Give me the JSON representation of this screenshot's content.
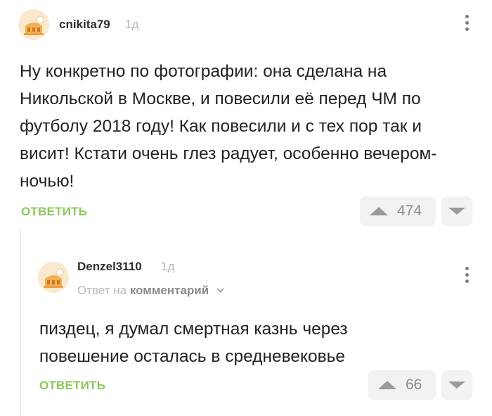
{
  "comment1": {
    "author": "cnikita79",
    "time": "1д",
    "text": "Ну конкретно по фотографии: она сделана на Никольской в Москве, и повесили её перед ЧМ по футболу 2018 году! Как повесили и с тех пор так и висит! Кстати очень глез радует, особенно вечером-ночью!",
    "reply_label": "ОТВЕТИТЬ",
    "rating": "474"
  },
  "comment2": {
    "author": "Denzel3110",
    "time": "1д",
    "reply_to_prefix": "Ответ на",
    "reply_to_link": "комментарий",
    "text": "пиздец, я думал смертная казнь через повешение осталась в средневековье",
    "reply_label": "ОТВЕТИТЬ",
    "rating": "66"
  },
  "colors": {
    "accent": "#8ac858",
    "muted": "#b8b8b8",
    "vote_bg": "#f2f2f2"
  },
  "icons": [
    "avatar-placeholder",
    "more-vertical-icon",
    "upvote-arrow-icon",
    "downvote-arrow-icon",
    "chevron-down-icon"
  ]
}
